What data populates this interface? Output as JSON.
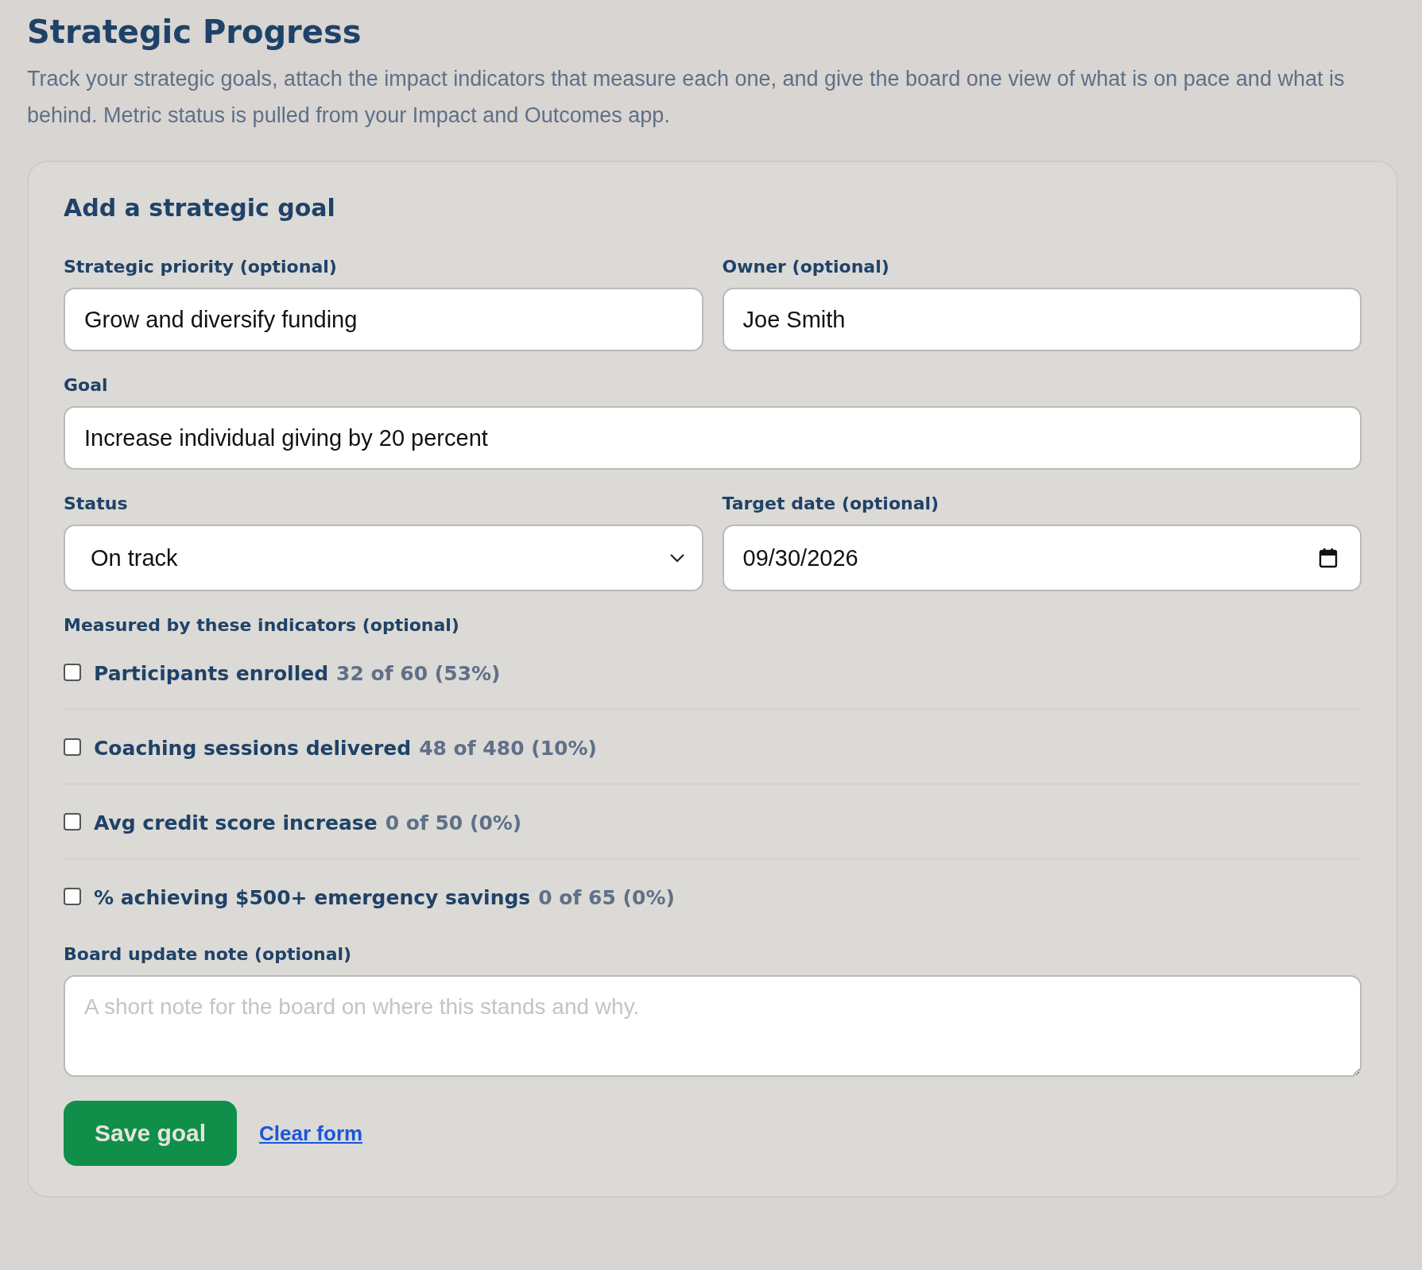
{
  "page": {
    "title": "Strategic Progress",
    "description": "Track your strategic goals, attach the impact indicators that measure each one, and give the board one view of what is on pace and what is behind. Metric status is pulled from your Impact and Outcomes app."
  },
  "form": {
    "heading": "Add a strategic goal",
    "priority": {
      "label": "Strategic priority (optional)",
      "value": "Grow and diversify funding"
    },
    "owner": {
      "label": "Owner (optional)",
      "value": "Joe Smith"
    },
    "goal": {
      "label": "Goal",
      "value": "Increase individual giving by 20 percent"
    },
    "status": {
      "label": "Status",
      "value": "On track"
    },
    "target_date": {
      "label": "Target date (optional)",
      "value": "09/30/2026"
    },
    "indicators_label": "Measured by these indicators (optional)",
    "indicators": [
      {
        "name": "Participants enrolled",
        "progress": "32 of 60 (53%)",
        "checked": false
      },
      {
        "name": "Coaching sessions delivered",
        "progress": "48 of 480 (10%)",
        "checked": false
      },
      {
        "name": "Avg credit score increase",
        "progress": "0 of 50 (0%)",
        "checked": false
      },
      {
        "name": "% achieving $500+ emergency savings",
        "progress": "0 of 65 (0%)",
        "checked": false
      }
    ],
    "note": {
      "label": "Board update note (optional)",
      "placeholder": "A short note for the board on where this stands and why."
    },
    "save_button": "Save goal",
    "clear_link": "Clear form"
  }
}
